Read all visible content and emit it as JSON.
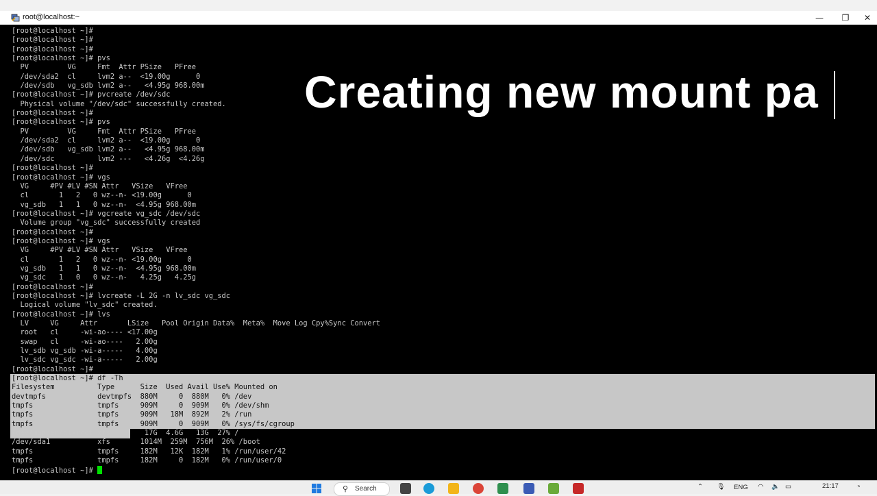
{
  "window": {
    "title": "root@localhost:~",
    "minimize_glyph": "—",
    "maximize_glyph": "❐",
    "close_glyph": "✕"
  },
  "overlay": {
    "title": "Creating new mount pa"
  },
  "terminal": {
    "lines": [
      "[root@localhost ~]#",
      "[root@localhost ~]#",
      "[root@localhost ~]#",
      "[root@localhost ~]# pvs",
      "  PV         VG     Fmt  Attr PSize   PFree",
      "  /dev/sda2  cl     lvm2 a--  <19.00g      0",
      "  /dev/sdb   vg_sdb lvm2 a--   <4.95g 968.00m",
      "[root@localhost ~]# pvcreate /dev/sdc",
      "  Physical volume \"/dev/sdc\" successfully created.",
      "[root@localhost ~]#",
      "[root@localhost ~]# pvs",
      "  PV         VG     Fmt  Attr PSize   PFree",
      "  /dev/sda2  cl     lvm2 a--  <19.00g      0",
      "  /dev/sdb   vg_sdb lvm2 a--   <4.95g 968.00m",
      "  /dev/sdc          lvm2 ---   <4.26g  <4.26g",
      "[root@localhost ~]#",
      "[root@localhost ~]# vgs",
      "  VG     #PV #LV #SN Attr   VSize   VFree",
      "  cl       1   2   0 wz--n- <19.00g      0",
      "  vg_sdb   1   1   0 wz--n-  <4.95g 968.00m",
      "[root@localhost ~]# vgcreate vg_sdc /dev/sdc",
      "  Volume group \"vg_sdc\" successfully created",
      "[root@localhost ~]#",
      "[root@localhost ~]# vgs",
      "  VG     #PV #LV #SN Attr   VSize   VFree",
      "  cl       1   2   0 wz--n- <19.00g      0",
      "  vg_sdb   1   1   0 wz--n-  <4.95g 968.00m",
      "  vg_sdc   1   0   0 wz--n-   4.25g   4.25g",
      "[root@localhost ~]#",
      "[root@localhost ~]# lvcreate -L 2G -n lv_sdc vg_sdc",
      "  Logical volume \"lv_sdc\" created.",
      "[root@localhost ~]# lvs",
      "  LV     VG     Attr       LSize   Pool Origin Data%  Meta%  Move Log Cpy%Sync Convert",
      "  root   cl     -wi-ao---- <17.00g",
      "  swap   cl     -wi-ao----   2.00g",
      "  lv_sdb vg_sdb -wi-a-----   4.00g",
      "  lv_sdc vg_sdc -wi-a-----   2.00g",
      "[root@localhost ~]#",
      "[root@localhost ~]# df -Th",
      "Filesystem          Type      Size  Used Avail Use% Mounted on",
      "devtmpfs            devtmpfs  880M     0  880M   0% /dev",
      "tmpfs               tmpfs     909M     0  909M   0% /dev/shm",
      "tmpfs               tmpfs     909M   18M  892M   2% /run",
      "tmpfs               tmpfs     909M     0  909M   0% /sys/fs/cgroup",
      "/dev/mapper/cl-root xfs        17G  4.6G   13G  27% /",
      "/dev/sda1           xfs       1014M  259M  756M  26% /boot",
      "tmpfs               tmpfs     182M   12K  182M   1% /run/user/42",
      "tmpfs               tmpfs     182M     0  182M   0% /run/user/0",
      "[root@localhost ~]# "
    ]
  },
  "taskbar": {
    "search_label": "Search",
    "search_glyph": "⚲",
    "language": "ENG",
    "clock": "21:17",
    "colors": {
      "start": "#1f7ae0",
      "edge": "#1a9bd8",
      "files": "#f2b51b",
      "chrome": "#db4437",
      "app": "#2f8f4e",
      "putty": "#3b5bb5",
      "notepad": "#6aaa3a",
      "red": "#c62828"
    }
  }
}
